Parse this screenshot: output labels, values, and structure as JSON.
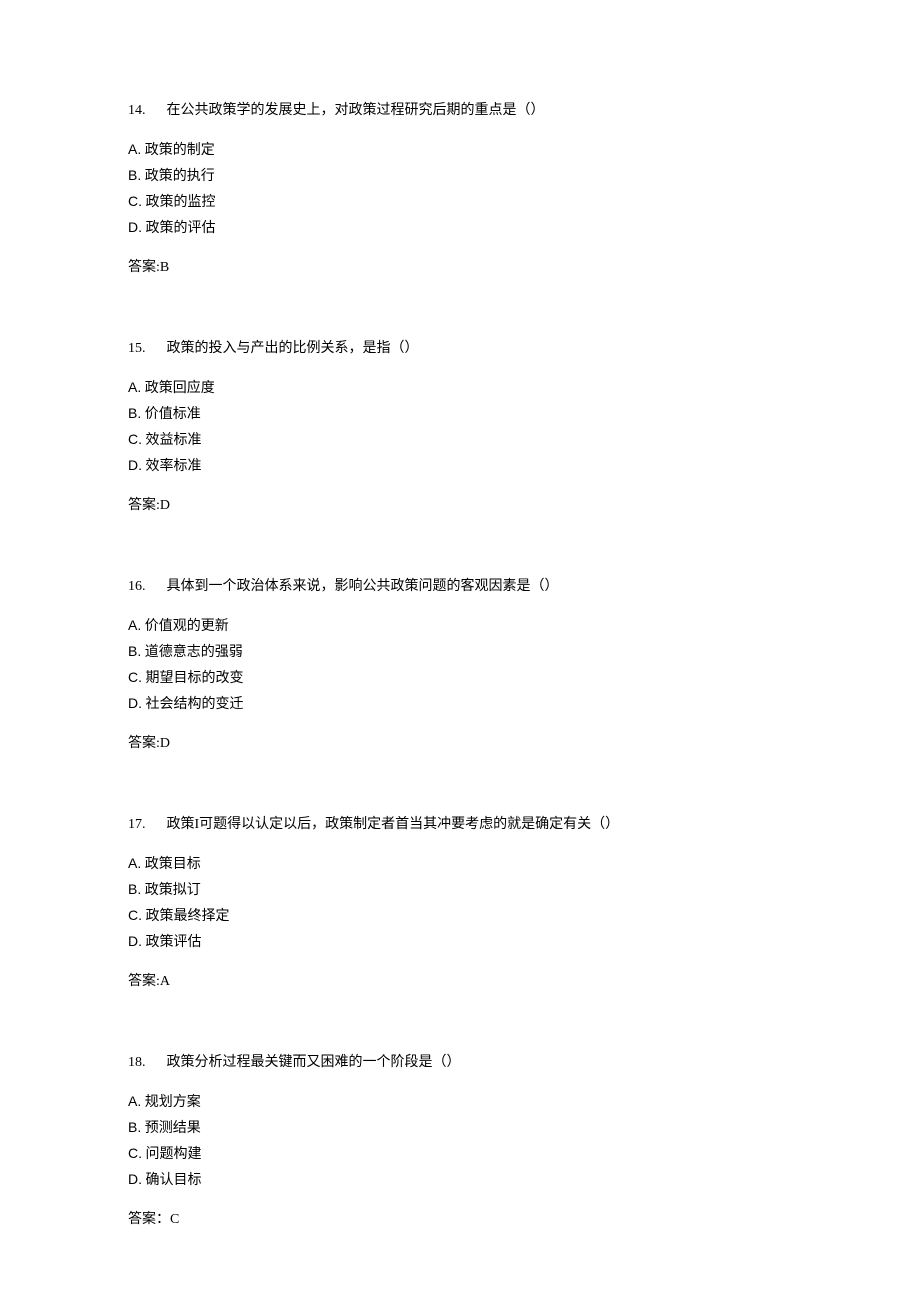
{
  "questions": [
    {
      "number": "14.",
      "stem": "在公共政策学的发展史上，对政策过程研究后期的重点是（）",
      "options": [
        {
          "letter": "A.",
          "text": "政策的制定"
        },
        {
          "letter": "B.",
          "text": "政策的执行"
        },
        {
          "letter": "C.",
          "text": "政策的监控"
        },
        {
          "letter": "D.",
          "text": "政策的评估"
        }
      ],
      "answer_label": "答案:B"
    },
    {
      "number": "15.",
      "stem": "政策的投入与产出的比例关系，是指（）",
      "options": [
        {
          "letter": "A.",
          "text": "政策回应度"
        },
        {
          "letter": "B.",
          "text": "价值标准"
        },
        {
          "letter": "C.",
          "text": "效益标准"
        },
        {
          "letter": "D.",
          "text": "效率标准"
        }
      ],
      "answer_label": "答案:D"
    },
    {
      "number": "16.",
      "stem": "具体到一个政治体系来说，影响公共政策问题的客观因素是（）",
      "options": [
        {
          "letter": "A.",
          "text": "价值观的更新"
        },
        {
          "letter": "B.",
          "text": "道德意志的强弱"
        },
        {
          "letter": "C.",
          "text": "期望目标的改变"
        },
        {
          "letter": "D.",
          "text": "社会结构的变迁"
        }
      ],
      "answer_label": "答案:D"
    },
    {
      "number": "17.",
      "stem": "政策I可题得以认定以后，政策制定者首当其冲要考虑的就是确定有关（）",
      "options": [
        {
          "letter": "A.",
          "text": "政策目标"
        },
        {
          "letter": "B.",
          "text": "政策拟订"
        },
        {
          "letter": "C.",
          "text": "政策最终择定"
        },
        {
          "letter": "D.",
          "text": "政策评估"
        }
      ],
      "answer_label": "答案:A"
    },
    {
      "number": "18.",
      "stem": "政策分析过程最关键而又困难的一个阶段是（）",
      "options": [
        {
          "letter": "A.",
          "text": "规划方案"
        },
        {
          "letter": "B.",
          "text": "预测结果"
        },
        {
          "letter": "C.",
          "text": "问题构建"
        },
        {
          "letter": "D.",
          "text": "确认目标"
        }
      ],
      "answer_label": "答案：C"
    }
  ]
}
